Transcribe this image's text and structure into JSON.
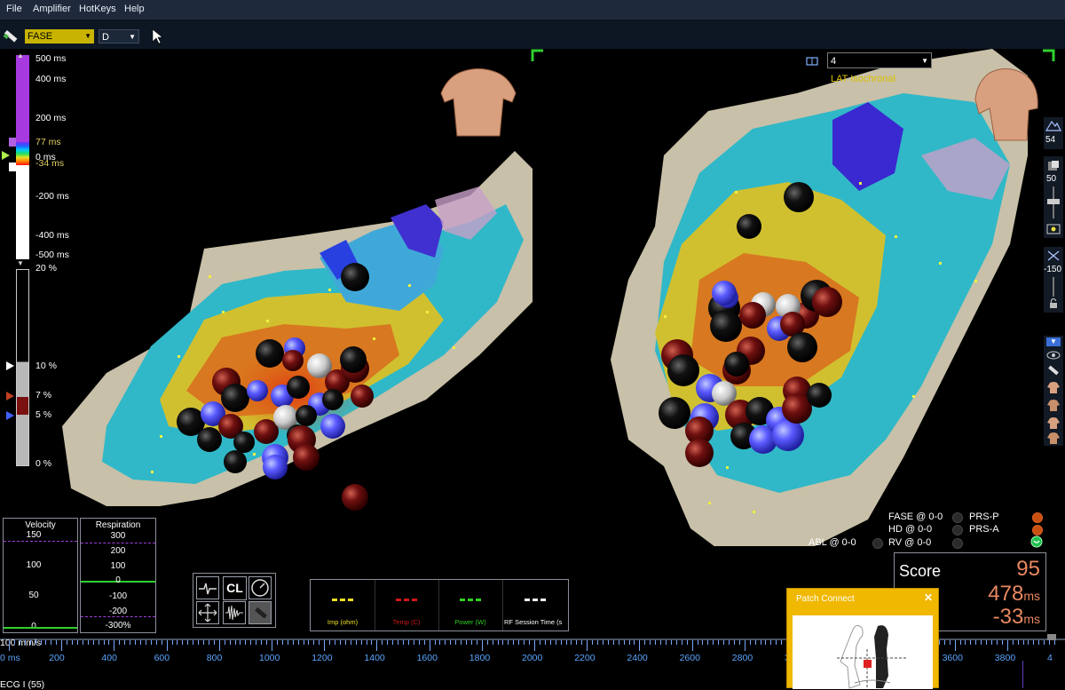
{
  "menu": [
    "File",
    "Amplifier",
    "HotKeys",
    "Help"
  ],
  "toolbar": {
    "mode_value": "FASE",
    "channel_value": "D"
  },
  "lat_scale": {
    "labels": [
      "500 ms",
      "400 ms",
      "200 ms",
      "77 ms",
      "0 ms",
      "-34 ms",
      "-200 ms",
      "-400 ms",
      "-500 ms"
    ]
  },
  "pct_scale": {
    "labels": [
      "20 %",
      "10 %",
      "7 %",
      "5 %",
      "0 %"
    ]
  },
  "view_right": {
    "dropdown_value": "4",
    "map_label": "LAT Isochronal"
  },
  "side_toolbar": {
    "value_54": "54",
    "value_50": "50",
    "value_minus150": "-150"
  },
  "velocity": {
    "title": "Velocity",
    "ticks": [
      "150",
      "100",
      "50",
      "0"
    ]
  },
  "respiration": {
    "title": "Respiration",
    "ticks": [
      "300",
      "200",
      "100",
      "0",
      "-100",
      "-200",
      "-300%"
    ]
  },
  "tools": {
    "cl_label": "CL"
  },
  "ablation": {
    "columns": [
      {
        "label": "Imp (ohm)",
        "color": "#f0e020"
      },
      {
        "label": "Temp (C)",
        "color": "#d01818"
      },
      {
        "label": "Power (W)",
        "color": "#30d020"
      },
      {
        "label": "RF Session Time (s",
        "color": "#ffffff"
      }
    ]
  },
  "status": {
    "fase": "FASE @ 0-0",
    "hd": "HD @ 0-0",
    "rv": "RV @ 0-0",
    "abl": "ABL @ 0-0",
    "prs_p": "PRS-P",
    "prs_a": "PRS-A"
  },
  "score": {
    "label": "Score",
    "value": "95",
    "ms1": "478",
    "ms2": "-33",
    "unit": "ms"
  },
  "patch": {
    "title": "Patch Connect",
    "close": "✕"
  },
  "ruler": {
    "speed": "100 mm/s",
    "start": "0 ms",
    "ticks": [
      "200",
      "400",
      "600",
      "800",
      "1000",
      "1200",
      "1400",
      "1600",
      "1800",
      "2000",
      "2200",
      "2400",
      "2600",
      "2800",
      "3000",
      "3200",
      "3400",
      "3600",
      "3800",
      "4"
    ],
    "ecg": "ECG I (55)"
  },
  "colors": {
    "accent": "#d8c000",
    "score_value": "#e88860",
    "patch_header": "#f0b800",
    "lat_purple": "#a040e0"
  }
}
